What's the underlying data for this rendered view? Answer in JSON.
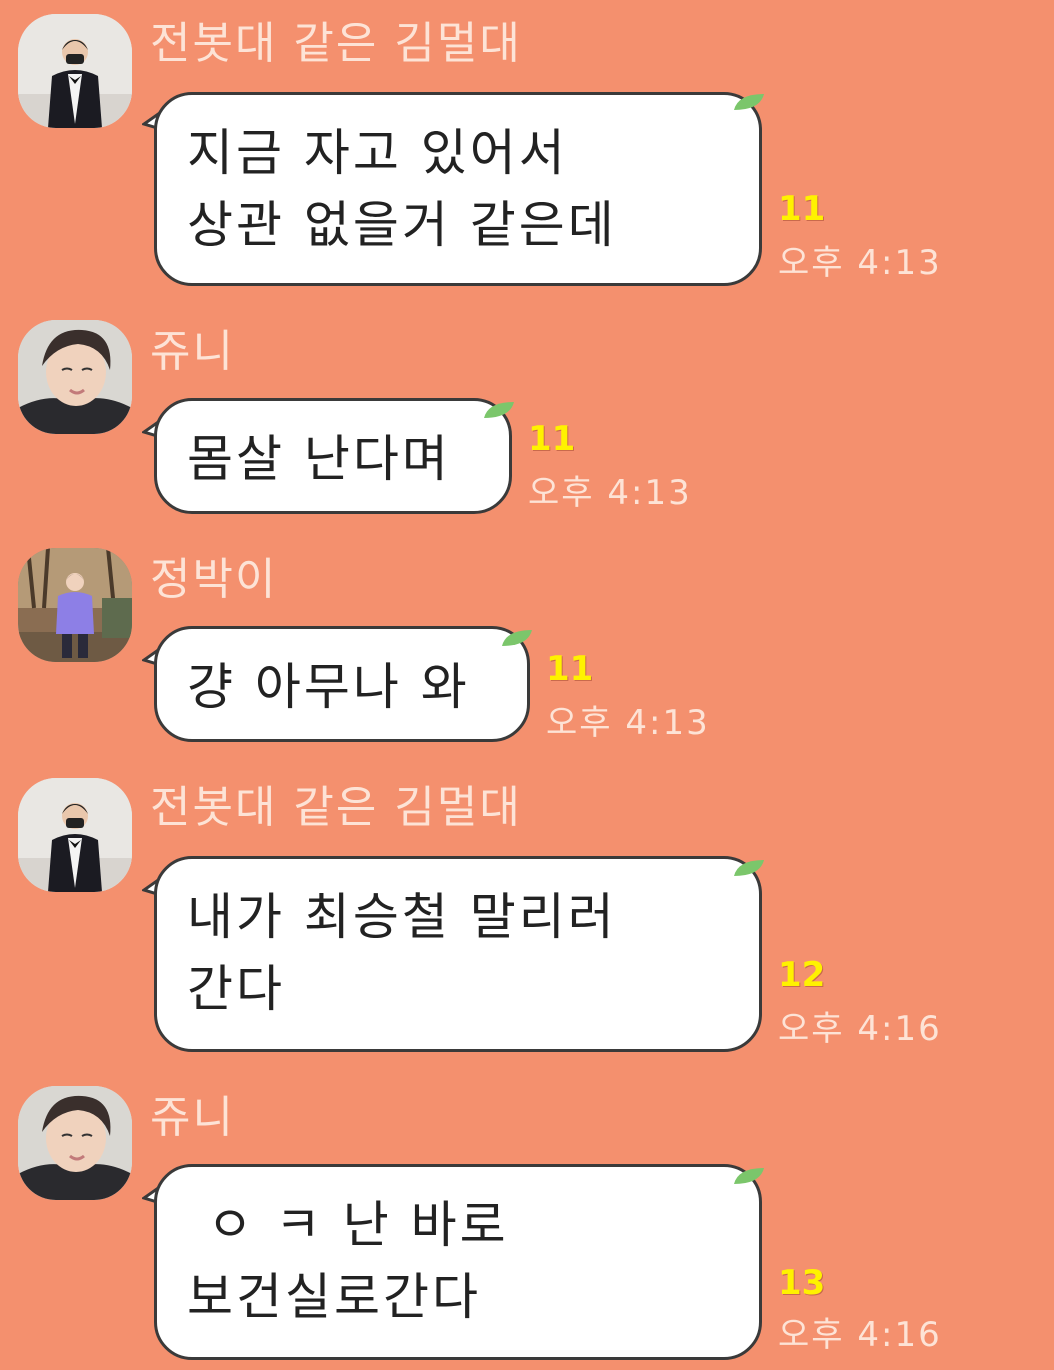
{
  "messages": [
    {
      "sender": "전봇대 같은 김멀대",
      "avatar": "avatar-man-in-tuxedo",
      "lines": [
        "지금 자고 있어서",
        "상관 없을거 같은데"
      ],
      "unread": "11",
      "time": "오후 4:13"
    },
    {
      "sender": "쥬니",
      "avatar": "avatar-man-selfie",
      "lines": [
        "몸살 난다며"
      ],
      "unread": "11",
      "time": "오후 4:13"
    },
    {
      "sender": "정박이",
      "avatar": "avatar-man-purple-sweater",
      "lines": [
        "걍 아무나 와"
      ],
      "unread": "11",
      "time": "오후 4:13"
    },
    {
      "sender": "전봇대 같은 김멀대",
      "avatar": "avatar-man-in-tuxedo",
      "lines": [
        "내가 최승철 말리러",
        "간다"
      ],
      "unread": "12",
      "time": "오후 4:16"
    },
    {
      "sender": "쥬니",
      "avatar": "avatar-man-selfie",
      "lines": [
        "ㅇ ㅋ 난 바로",
        "보건실로간다"
      ],
      "unread": "13",
      "time": "오후 4:16"
    }
  ],
  "colors": {
    "background": "#f4906e",
    "bubble": "#ffffff",
    "unread": "#fff200",
    "meta_text": "#fde3d6",
    "leaf": "#7bc66b"
  }
}
